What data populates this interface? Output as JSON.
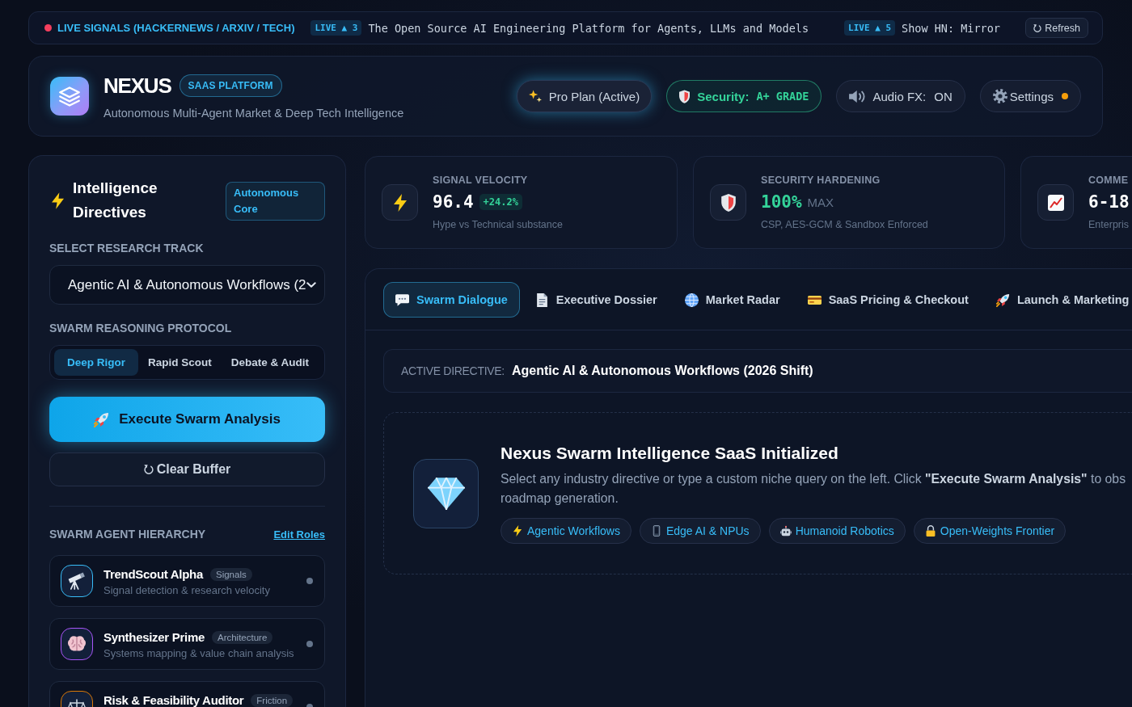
{
  "ticker": {
    "title": "LIVE SIGNALS (HACKERNEWS / ARXIV / TECH)",
    "items": [
      {
        "badge": "LIVE ▲ 3",
        "text": "The Open Source AI Engineering Platform for Agents, LLMs and Models"
      },
      {
        "badge": "LIVE ▲ 5",
        "text": "Show HN: Mirror"
      }
    ],
    "refresh_button": "Refresh"
  },
  "header": {
    "brand": "NEXUS",
    "brand_badge": "SAAS PLATFORM",
    "tagline": "Autonomous Multi-Agent Market & Deep Tech Intelligence",
    "plan_button": "Pro Plan (Active)",
    "security": {
      "label": "Security:",
      "grade": "A+ GRADE"
    },
    "audio": {
      "label": "Audio FX:",
      "value": "ON"
    },
    "settings": {
      "label": "Settings",
      "notification": true
    }
  },
  "sidebar": {
    "title": "Intelligence Directives",
    "badge": "Autonomous Core",
    "track_label": "SELECT RESEARCH TRACK",
    "track_value": "Agentic AI & Autonomous Workflows (2",
    "protocol_label": "SWARM REASONING PROTOCOL",
    "protocols": [
      {
        "label": "Deep Rigor",
        "selected": true
      },
      {
        "label": "Rapid Scout",
        "selected": false
      },
      {
        "label": "Debate & Audit",
        "selected": false
      }
    ],
    "execute_button": "Execute Swarm Analysis",
    "clear_button": "Clear Buffer",
    "agents_label": "SWARM AGENT HIERARCHY",
    "edit_link": "Edit Roles",
    "agents": [
      {
        "name": "TrendScout Alpha",
        "tag": "Signals",
        "description": "Signal detection & research velocity",
        "color": "#38bdf8",
        "online": false
      },
      {
        "name": "Synthesizer Prime",
        "tag": "Architecture",
        "description": "Systems mapping & value chain analysis",
        "color": "#a855f7",
        "online": false
      },
      {
        "name": "Risk & Feasibility Auditor",
        "tag": "Friction",
        "color": "#d97706",
        "online": false
      }
    ]
  },
  "stats": [
    {
      "label": "SIGNAL VELOCITY",
      "value": "96.4",
      "delta": "+24.2%",
      "caption": "Hype vs Technical substance",
      "accent": false
    },
    {
      "label": "SECURITY HARDENING",
      "value": "100%",
      "unit": "MAX",
      "caption": "CSP, AES-GCM & Sandbox Enforced",
      "accent": true
    },
    {
      "label": "COMME",
      "value": "6-18",
      "caption": "Enterpris",
      "accent": false
    }
  ],
  "main": {
    "tabs": [
      {
        "label": "Swarm Dialogue",
        "selected": true
      },
      {
        "label": "Executive Dossier",
        "selected": false
      },
      {
        "label": "Market Radar",
        "selected": false
      },
      {
        "label": "SaaS Pricing & Checkout",
        "selected": false
      },
      {
        "label": "Launch & Marketing",
        "selected": false
      }
    ],
    "directive": {
      "label": "ACTIVE DIRECTIVE:",
      "value": "Agentic AI & Autonomous Workflows (2026 Shift)"
    },
    "intro": {
      "title": "Nexus Swarm Intelligence SaaS Initialized",
      "description": [
        "Select any industry directive or type a custom niche query on the left. Click **\"Execute Swarm Analysis\"** to obs",
        "roadmap generation."
      ],
      "chips": [
        "Agentic Workflows",
        "Edge AI & NPUs",
        "Humanoid Robotics",
        "Open-Weights Frontier"
      ]
    }
  }
}
